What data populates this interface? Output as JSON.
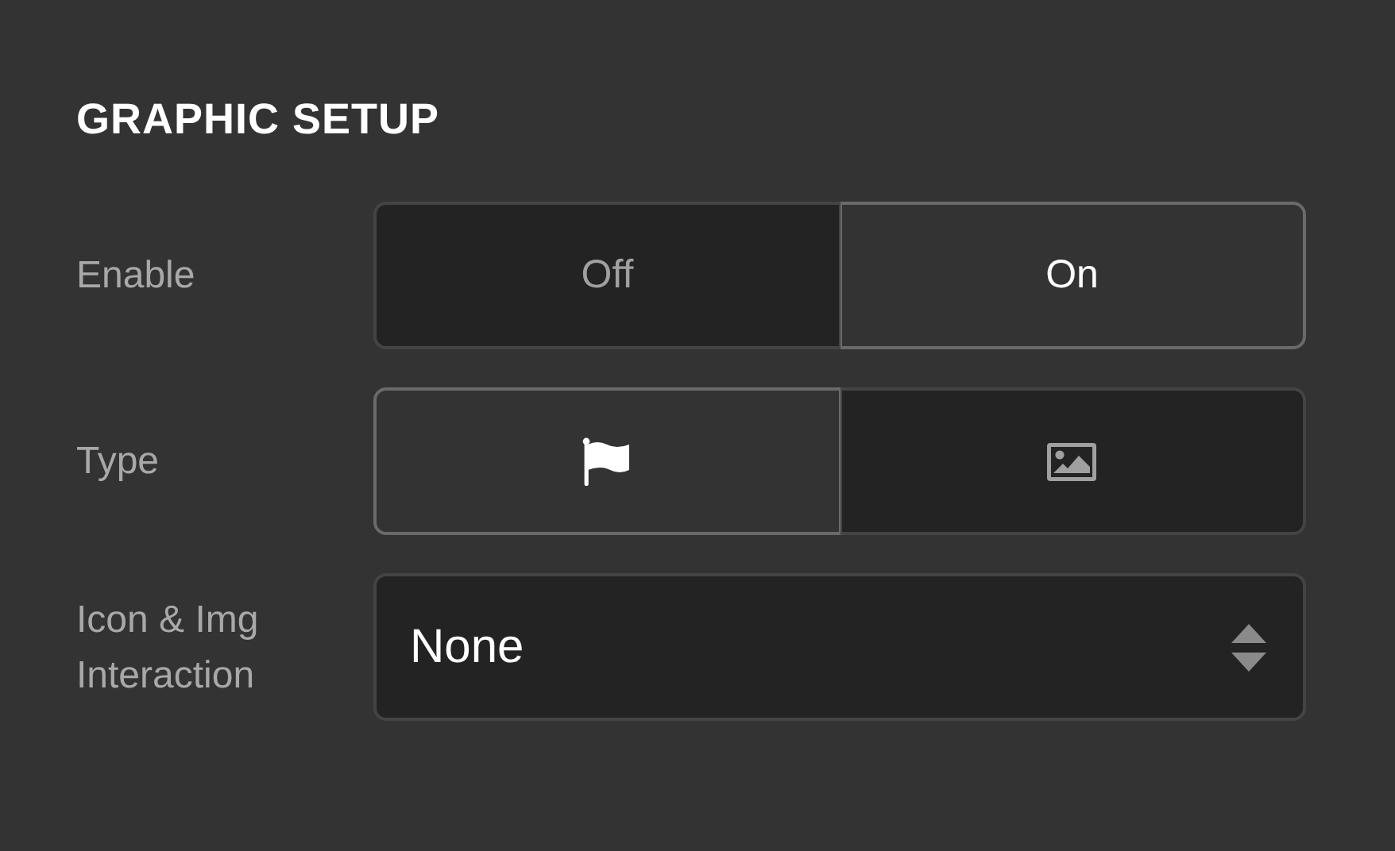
{
  "title": "GRAPHIC SETUP",
  "rows": [
    {
      "label": "Enable",
      "kind": "segmented",
      "options": [
        {
          "text": "Off",
          "selected": false
        },
        {
          "text": "On",
          "selected": true
        }
      ]
    },
    {
      "label": "Type",
      "kind": "segmented",
      "options": [
        {
          "kind": "flag",
          "selected": true
        },
        {
          "kind": "image",
          "selected": false
        }
      ]
    },
    {
      "label": "Icon & Img Interaction",
      "kind": "select",
      "value": "None"
    }
  ]
}
